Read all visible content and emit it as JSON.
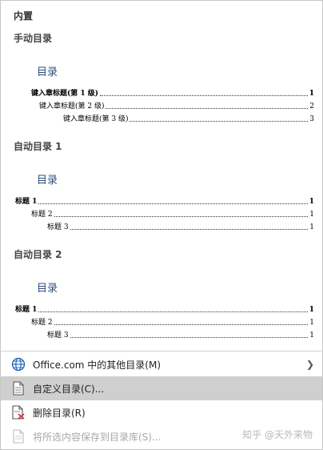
{
  "header": {
    "builtin": "内置"
  },
  "gallery": [
    {
      "title": "手动目录",
      "toc_heading": "目录",
      "lines": [
        {
          "text": "键入章标题(第 1 级)",
          "page": "1",
          "bold": true
        },
        {
          "text": "键入章标题(第 2 级)",
          "page": "2",
          "bold": false
        },
        {
          "text": "键入章标题(第 3 级)",
          "page": "3",
          "bold": false
        }
      ]
    },
    {
      "title": "自动目录 1",
      "toc_heading": "目录",
      "lines": [
        {
          "text": "标题 1",
          "page": "1",
          "bold": true
        },
        {
          "text": "标题 2",
          "page": "1",
          "bold": false
        },
        {
          "text": "标题 3",
          "page": "1",
          "bold": false
        }
      ]
    },
    {
      "title": "自动目录 2",
      "toc_heading": "目录",
      "lines": [
        {
          "text": "标题 1",
          "page": "1",
          "bold": true
        },
        {
          "text": "标题 2",
          "page": "1",
          "bold": false
        },
        {
          "text": "标题 3",
          "page": "1",
          "bold": false
        }
      ]
    }
  ],
  "menu": [
    {
      "label": "Office.com 中的其他目录(M)",
      "icon": "globe-icon",
      "has_submenu": true,
      "state": "normal"
    },
    {
      "label": "自定义目录(C)...",
      "icon": "document-icon",
      "has_submenu": false,
      "state": "hover"
    },
    {
      "label": "删除目录(R)",
      "icon": "delete-document-icon",
      "has_submenu": false,
      "state": "normal"
    },
    {
      "label": "将所选内容保存到目录库(S)...",
      "icon": "save-document-icon",
      "has_submenu": false,
      "state": "disabled"
    }
  ],
  "watermark": "知乎 @天外来物",
  "colors": {
    "toc_heading": "#2f4e7a",
    "hover_bg": "#cfcfcf",
    "delete_red": "#d13438",
    "globe_blue": "#1a5fb4"
  }
}
